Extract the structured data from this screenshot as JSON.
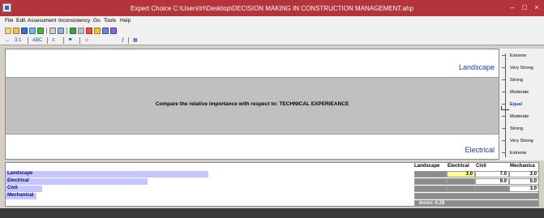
{
  "window": {
    "title": "Expert Choice    C:\\Users\\H\\Desktop\\DECISION MAKING IN CONSTRUCTION MANAGEMENT.ahp",
    "minimize": "–",
    "maximize": "□",
    "close": "×"
  },
  "menu": [
    "File",
    "Edit",
    "Assessment",
    "Inconsistency",
    "Go",
    "Tools",
    "Help"
  ],
  "toolbar2": [
    "3:1",
    "ABC",
    "≡",
    "⚑",
    "☺",
    "▦"
  ],
  "compare": {
    "left": "Landscape",
    "right": "Electrical",
    "question": "Compare the relative importance with respect to: TECHNICAL EXPERIEANCE"
  },
  "scale": [
    "Extreme",
    "Very Strong",
    "Strong",
    "Moderate",
    "Equal",
    "Moderate",
    "Strong",
    "Very Strong",
    "Extreme"
  ],
  "scale_selected_index": 4,
  "matrix": {
    "columns": [
      "Landscape",
      "Electrical",
      "Civil",
      "Mechanica"
    ],
    "rows": [
      {
        "label": "Landscape",
        "bar": 0.5,
        "cells": [
          "",
          "3.0",
          "7.0",
          "3.0"
        ]
      },
      {
        "label": "Electrical",
        "bar": 0.35,
        "cells": [
          "",
          "",
          "9.0",
          "5.0"
        ]
      },
      {
        "label": "Civil",
        "bar": 0.09,
        "cells": [
          "",
          "",
          "",
          "3.0"
        ]
      },
      {
        "label": "Mechanical",
        "bar": 0.075,
        "cells": [
          "",
          "",
          "",
          ""
        ]
      }
    ],
    "inconsistency": "Incon: 0.28"
  },
  "colors": {
    "titlebar": "#b4343a",
    "accent": "#1a3aa8",
    "bar": "#c5c5ff",
    "highlight": "#ffff99"
  }
}
